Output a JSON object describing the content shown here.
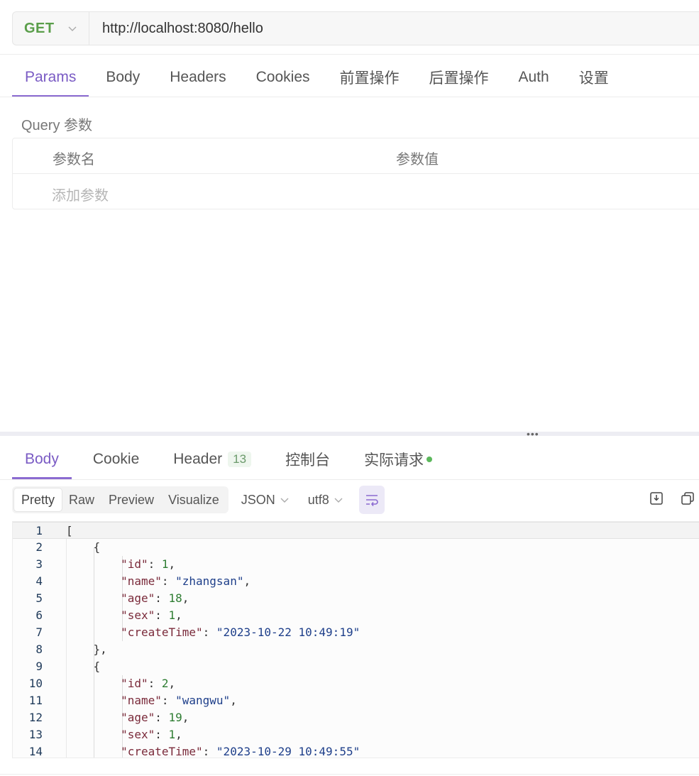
{
  "request": {
    "method": "GET",
    "url": "http://localhost:8080/hello",
    "tabs": [
      "Params",
      "Body",
      "Headers",
      "Cookies",
      "前置操作",
      "后置操作",
      "Auth",
      "设置"
    ],
    "active_tab": "Params"
  },
  "params": {
    "section_title": "Query 参数",
    "col_name": "参数名",
    "col_value": "参数值",
    "add_placeholder": "添加参数"
  },
  "response": {
    "tabs": [
      "Body",
      "Cookie",
      "Header",
      "控制台",
      "实际请求"
    ],
    "header_count": "13",
    "active_tab": "Body",
    "view_modes": [
      "Pretty",
      "Raw",
      "Preview",
      "Visualize"
    ],
    "active_view": "Pretty",
    "format": "JSON",
    "encoding": "utf8",
    "status_dot_color": "#5cb85c"
  },
  "code_lines": [
    {
      "no": "1",
      "text": "["
    },
    {
      "no": "2",
      "text": "    {"
    },
    {
      "no": "3",
      "key": "\"id\"",
      "val": "1",
      "vtype": "n",
      "tail": ","
    },
    {
      "no": "4",
      "key": "\"name\"",
      "val": "\"zhangsan\"",
      "vtype": "s",
      "tail": ","
    },
    {
      "no": "5",
      "key": "\"age\"",
      "val": "18",
      "vtype": "n",
      "tail": ","
    },
    {
      "no": "6",
      "key": "\"sex\"",
      "val": "1",
      "vtype": "n",
      "tail": ","
    },
    {
      "no": "7",
      "key": "\"createTime\"",
      "val": "\"2023-10-22 10:49:19\"",
      "vtype": "s",
      "tail": ""
    },
    {
      "no": "8",
      "text": "    },"
    },
    {
      "no": "9",
      "text": "    {"
    },
    {
      "no": "10",
      "key": "\"id\"",
      "val": "2",
      "vtype": "n",
      "tail": ","
    },
    {
      "no": "11",
      "key": "\"name\"",
      "val": "\"wangwu\"",
      "vtype": "s",
      "tail": ","
    },
    {
      "no": "12",
      "key": "\"age\"",
      "val": "19",
      "vtype": "n",
      "tail": ","
    },
    {
      "no": "13",
      "key": "\"sex\"",
      "val": "1",
      "vtype": "n",
      "tail": ","
    },
    {
      "no": "14",
      "key": "\"createTime\"",
      "val": "\"2023-10-29 10:49:55\"",
      "vtype": "s",
      "tail": ""
    }
  ],
  "colors": {
    "accent": "#8b6bd1",
    "method_get": "#5a9e4a",
    "json_key": "#7a2a3a",
    "json_string": "#1e3f8a",
    "json_number": "#2e7d32"
  }
}
